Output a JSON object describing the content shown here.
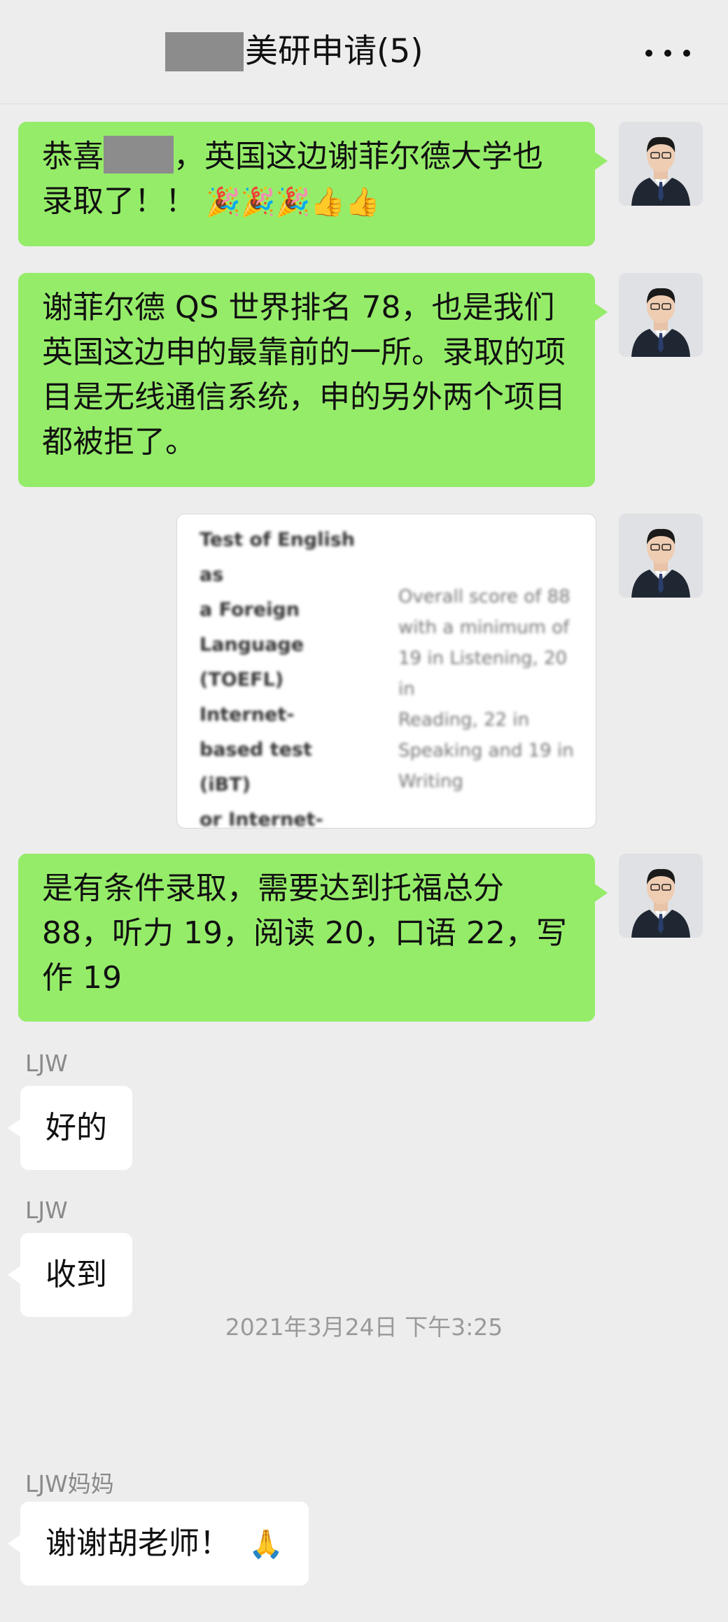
{
  "header": {
    "title": "美研申请(5)",
    "more_icon": "more-dots-icon"
  },
  "messages": [
    {
      "sender": "me",
      "text_before": "恭喜",
      "text_after": "，英国这边谢菲尔德大学也录取了！！",
      "emojis": "🎉🎉🎉👍👍"
    },
    {
      "sender": "me",
      "text": "谢菲尔德 QS 世界排名 78，也是我们英国这边申的最靠前的一所。录取的项目是无线通信系统，申的另外两个项目都被拒了。"
    },
    {
      "sender": "me",
      "type": "image",
      "image_left_text": "Test of English as\na Foreign\nLanguage\n(TOEFL) Internet-\nbased test (iBT)\nor Internet-\nbased test (iBT)\nHome Edition***",
      "image_right_text": "Overall score of 88\nwith a minimum of\n19 in Listening, 20 in\nReading, 22 in\nSpeaking and 19 in\nWriting"
    },
    {
      "sender": "me",
      "text": "是有条件录取，需要达到托福总分 88，听力 19，阅读 20，口语 22，写作 19"
    },
    {
      "sender": "LJW",
      "sender_label": "LJW",
      "text": "好的"
    },
    {
      "sender": "LJW",
      "sender_label": "LJW",
      "text": "收到"
    },
    {
      "timestamp": "2021年3月24日 下午3:25"
    },
    {
      "sender": "LJW妈妈",
      "sender_label": "LJW妈妈",
      "text": "谢谢胡老师！",
      "emoji": "🙏"
    }
  ]
}
